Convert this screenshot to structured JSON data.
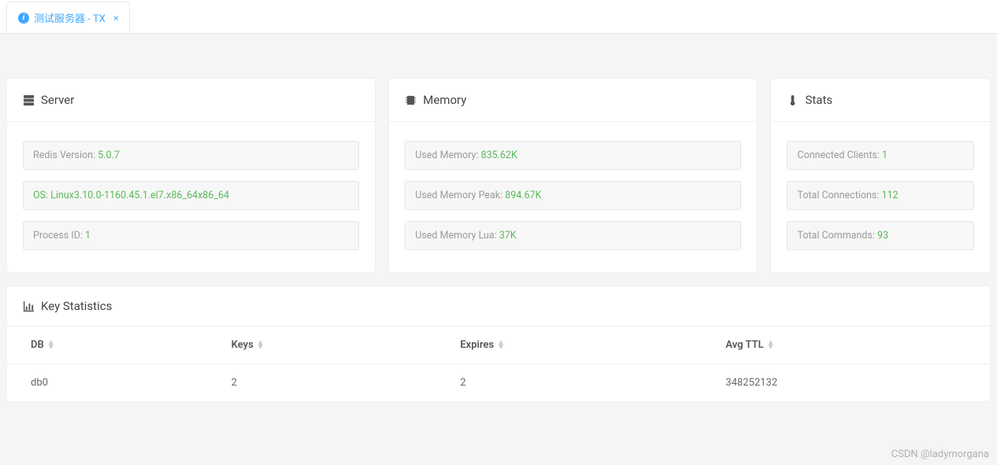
{
  "tab": {
    "label": "测试服务器 - TX"
  },
  "server": {
    "title": "Server",
    "rows": [
      {
        "label": "Redis Version: ",
        "value": "5.0.7",
        "highlight": false
      },
      {
        "label": "OS: ",
        "value": "Linux3.10.0-1160.45.1.el7.x86_64x86_64",
        "highlight": true
      },
      {
        "label": "Process ID: ",
        "value": "1",
        "highlight": false
      }
    ]
  },
  "memory": {
    "title": "Memory",
    "rows": [
      {
        "label": "Used Memory: ",
        "value": "835.62K"
      },
      {
        "label": "Used Memory Peak: ",
        "value": "894.67K"
      },
      {
        "label": "Used Memory Lua: ",
        "value": "37K"
      }
    ]
  },
  "stats": {
    "title": "Stats",
    "rows": [
      {
        "label": "Connected Clients: ",
        "value": "1"
      },
      {
        "label": "Total Connections: ",
        "value": "112"
      },
      {
        "label": "Total Commands: ",
        "value": "93"
      }
    ]
  },
  "keystats": {
    "title": "Key Statistics",
    "columns": [
      "DB",
      "Keys",
      "Expires",
      "Avg TTL"
    ],
    "rows": [
      {
        "db": "db0",
        "keys": "2",
        "expires": "2",
        "avgttl": "348252132"
      }
    ]
  },
  "watermark": "CSDN @ladymorgana"
}
